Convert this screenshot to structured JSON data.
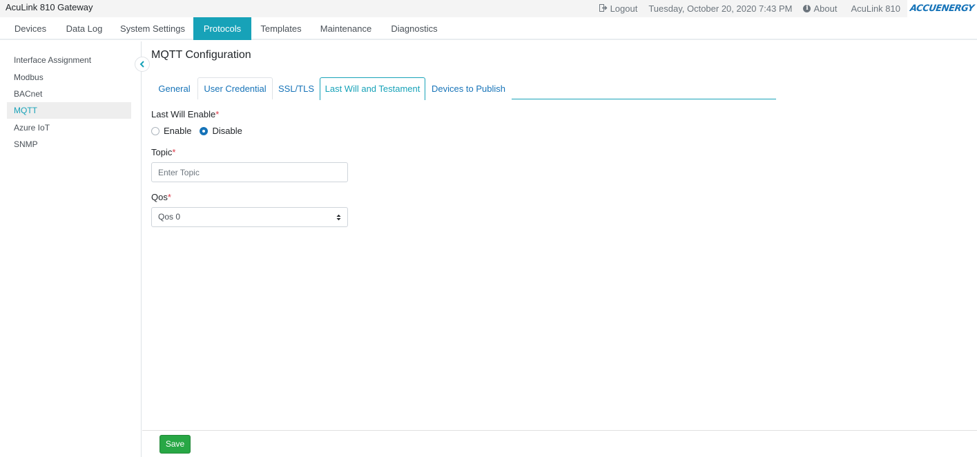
{
  "app": {
    "title": "AcuLink 810 Gateway"
  },
  "top_right": {
    "logout_label": "Logout",
    "datetime": "Tuesday, October 20, 2020 7:43 PM",
    "about_label": "About",
    "device_name": "AcuLink 810",
    "brand_text": "ACCUENERGY"
  },
  "nav": {
    "items": [
      "Devices",
      "Data Log",
      "System Settings",
      "Protocols",
      "Templates",
      "Maintenance",
      "Diagnostics"
    ],
    "active": "Protocols"
  },
  "sidebar": {
    "items": [
      "Interface Assignment",
      "Modbus",
      "BACnet",
      "MQTT",
      "Azure IoT",
      "SNMP"
    ],
    "active": "MQTT"
  },
  "page": {
    "title": "MQTT Configuration"
  },
  "tabs": {
    "items": [
      "General",
      "User Credential",
      "SSL/TLS",
      "Last Will and Testament",
      "Devices to Publish"
    ],
    "active": "Last Will and Testament"
  },
  "form": {
    "last_will_enable": {
      "label": "Last Will Enable",
      "required_mark": "*",
      "options": [
        "Enable",
        "Disable"
      ],
      "selected": "Disable"
    },
    "topic": {
      "label": "Topic",
      "required_mark": "*",
      "value": "",
      "placeholder": "Enter Topic"
    },
    "qos": {
      "label": "Qos",
      "required_mark": "*",
      "selected": "Qos 0"
    }
  },
  "footer": {
    "save_label": "Save"
  },
  "colors": {
    "accent": "#17a2b8",
    "link": "#1673b8",
    "save": "#28a745",
    "required": "#dc3545",
    "topbar_bg": "#f4f4f4"
  }
}
